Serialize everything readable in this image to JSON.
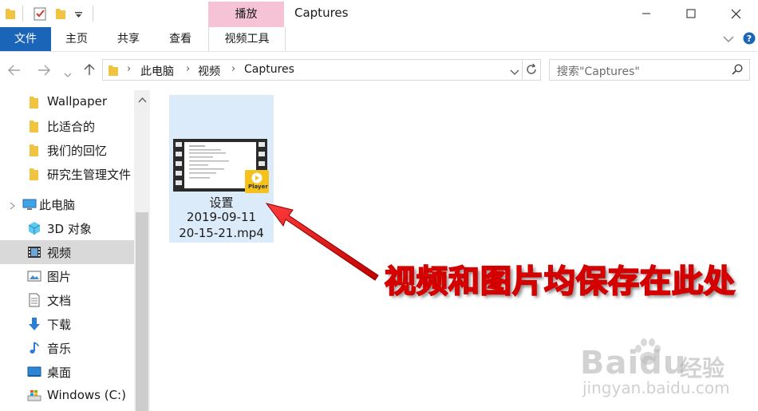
{
  "window": {
    "title": "Captures",
    "context_tab": "播放"
  },
  "ribbon": {
    "tabs": [
      "文件",
      "主页",
      "共享",
      "查看",
      "视频工具"
    ]
  },
  "address": {
    "breadcrumbs": [
      "此电脑",
      "视频",
      "Captures"
    ],
    "search_placeholder": "搜索\"Captures\""
  },
  "nav": {
    "items": [
      {
        "label": "Wallpaper",
        "icon": "folder-icon"
      },
      {
        "label": "比适合的",
        "icon": "folder-icon"
      },
      {
        "label": "我们的回忆",
        "icon": "folder-icon"
      },
      {
        "label": "研究生管理文件",
        "icon": "folder-icon"
      },
      {
        "label": "此电脑",
        "icon": "computer-icon"
      },
      {
        "label": "3D 对象",
        "icon": "cube-icon"
      },
      {
        "label": "视频",
        "icon": "film-icon",
        "selected": true
      },
      {
        "label": "图片",
        "icon": "picture-icon"
      },
      {
        "label": "文档",
        "icon": "document-icon"
      },
      {
        "label": "下载",
        "icon": "download-arrow-icon"
      },
      {
        "label": "音乐",
        "icon": "music-note-icon"
      },
      {
        "label": "桌面",
        "icon": "desktop-icon"
      },
      {
        "label": "Windows (C:)",
        "icon": "drive-icon"
      }
    ]
  },
  "content": {
    "file": {
      "name_line1": "设置",
      "name_line2": "2019-09-11",
      "name_line3": "20-15-21.mp4",
      "badge": "Player"
    }
  },
  "annotation": {
    "callout": "视频和图片均保存在此处"
  },
  "watermark": {
    "logo": "Baidu",
    "logo_cn": "经验",
    "url": "jingyan.baidu.com"
  },
  "colors": {
    "file_tab": "#1a65b8",
    "context_tab": "#f6c3d6",
    "selection": "#dcebfa",
    "callout_outline": "#d40000"
  }
}
